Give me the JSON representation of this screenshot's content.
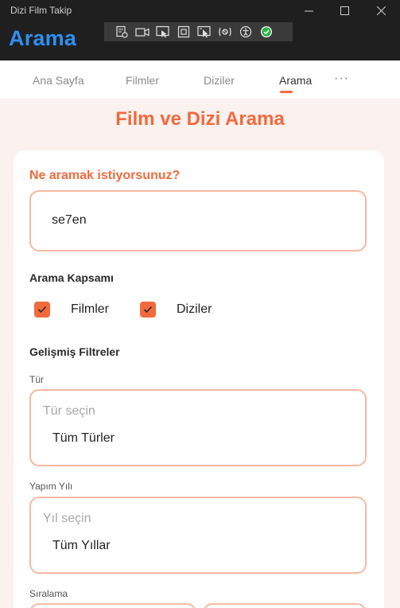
{
  "window": {
    "app_title": "Dizi Film Takip",
    "page_heading": "Arama",
    "controls": {
      "minimize": "—",
      "maximize": "☐",
      "close": "✕"
    }
  },
  "debug_toolbar": {
    "icons": [
      "live-visual-tree-icon",
      "video-icon",
      "select-element-icon",
      "display-layout-icon",
      "track-focus-icon",
      "hot-reload-icon",
      "accessibility-icon",
      "check-status-icon"
    ]
  },
  "nav": {
    "items": [
      {
        "label": "Ana Sayfa",
        "active": false
      },
      {
        "label": "Filmler",
        "active": false
      },
      {
        "label": "Diziler",
        "active": false
      },
      {
        "label": "Arama",
        "active": true
      }
    ],
    "more": "···"
  },
  "search": {
    "title": "Film ve Dizi Arama",
    "question_label": "Ne aramak istiyorsunuz?",
    "query_value": "se7en",
    "scope_label": "Arama Kapsamı",
    "scope_options": [
      {
        "label": "Filmler",
        "checked": true
      },
      {
        "label": "Diziler",
        "checked": true
      }
    ],
    "advanced_label": "Gelişmiş Filtreler",
    "genre": {
      "label": "Tür",
      "placeholder": "Tür seçin",
      "value": "Tüm Türler"
    },
    "year": {
      "label": "Yapım Yılı",
      "placeholder": "Yıl seçin",
      "value": "Tüm Yıllar"
    },
    "sort": {
      "label": "Sıralama"
    }
  },
  "colors": {
    "accent": "#f26a3d",
    "heading_blue": "#2f8ff0",
    "input_border": "#f5b9a0",
    "content_bg": "#fbf1ee"
  }
}
